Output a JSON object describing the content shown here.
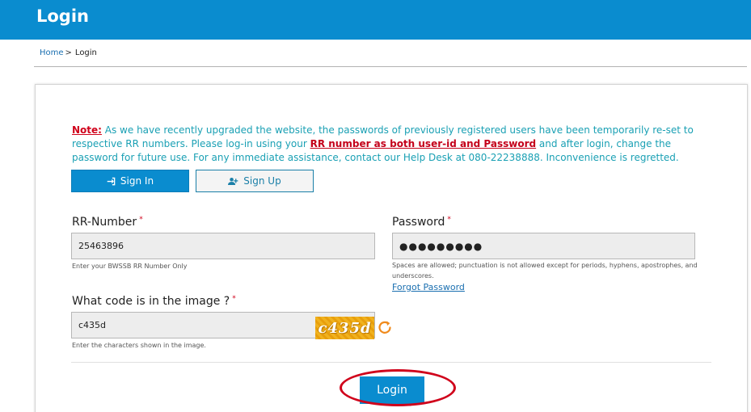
{
  "header": {
    "title": "Login"
  },
  "breadcrumb": {
    "home": "Home",
    "separator": ">",
    "current": "Login"
  },
  "note": {
    "label": "Note:",
    "text_before": " As we have recently upgraded the website, the passwords of previously registered users have been temporarily re-set to respective RR numbers. Please log-in using your ",
    "emphasis": "RR number as both user-id and Password",
    "text_after": " and after login, change the password for future use. For any immediate assistance, contact our Help Desk at 080-22238888. Inconvenience is regretted."
  },
  "tabs": [
    {
      "label": "Sign In",
      "icon": "sign-in-icon",
      "active": true
    },
    {
      "label": "Sign Up",
      "icon": "user-plus-icon",
      "active": false
    }
  ],
  "form": {
    "rr_number": {
      "label": "RR-Number",
      "required": "*",
      "value": "25463896",
      "hint": "Enter your BWSSB RR Number Only"
    },
    "password": {
      "label": "Password",
      "required": "*",
      "value": "●●●●●●●●●",
      "hint": "Spaces are allowed; punctuation is not allowed except for periods, hyphens, apostrophes, and underscores."
    },
    "forgot_password": "Forgot Password",
    "captcha": {
      "label": "What code is in the image ?",
      "required": "*",
      "value": "c435d",
      "image_text": "c435d",
      "hint": "Enter the characters shown in the image.",
      "refresh_icon": "refresh-icon"
    },
    "login_button": "Login"
  },
  "colors": {
    "brand": "#0a8ccf",
    "note_text": "#1aa0b4",
    "note_alert": "#d0021b",
    "captcha_bg": "#f0b21e",
    "annotation_circle": "#d0021b"
  }
}
